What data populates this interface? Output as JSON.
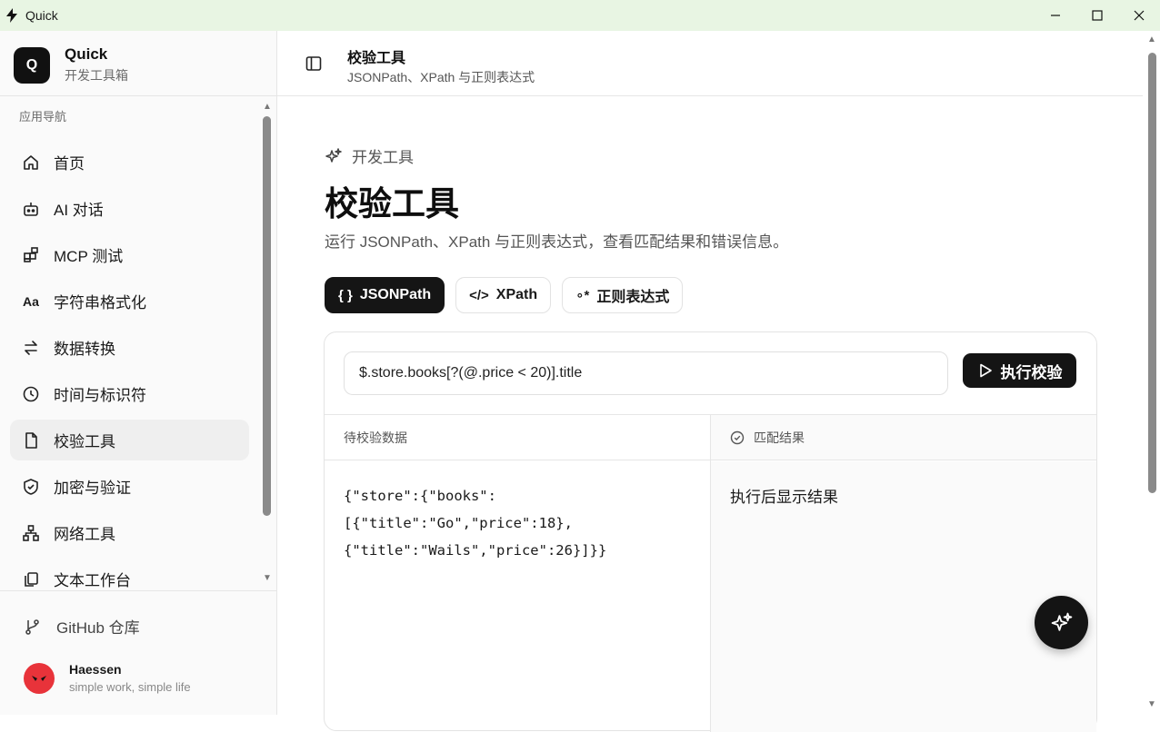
{
  "window": {
    "title": "Quick",
    "controls": [
      "minimize-icon",
      "maximize-icon",
      "close-icon"
    ]
  },
  "sidebar": {
    "brand": {
      "logo_letter": "Q",
      "name": "Quick",
      "subtitle": "开发工具箱"
    },
    "nav_title": "应用导航",
    "items": [
      {
        "label": "首页",
        "icon": "home-icon"
      },
      {
        "label": "AI 对话",
        "icon": "bot-icon"
      },
      {
        "label": "MCP 测试",
        "icon": "blocks-icon"
      },
      {
        "label": "字符串格式化",
        "icon": "case-icon"
      },
      {
        "label": "数据转换",
        "icon": "arrows-swap-icon"
      },
      {
        "label": "时间与标识符",
        "icon": "clock-icon"
      },
      {
        "label": "校验工具",
        "icon": "file-check-icon",
        "active": true
      },
      {
        "label": "加密与验证",
        "icon": "shield-icon"
      },
      {
        "label": "网络工具",
        "icon": "network-icon"
      },
      {
        "label": "文本工作台",
        "icon": "copy-icon"
      }
    ],
    "github_label": "GitHub 仓库",
    "user": {
      "name": "Haessen",
      "motto": "simple work, simple life"
    }
  },
  "header": {
    "title": "校验工具",
    "subtitle": "JSONPath、XPath 与正则表达式"
  },
  "main": {
    "eyebrow": "开发工具",
    "title": "校验工具",
    "description": "运行 JSONPath、XPath 与正则表达式，查看匹配结果和错误信息。",
    "tabs": [
      {
        "label": "JSONPath",
        "icon_text": "{ }",
        "active": true
      },
      {
        "label": "XPath",
        "icon_text": "</>",
        "active": false
      },
      {
        "label": "正则表达式",
        "icon_text": "∘*",
        "active": false
      }
    ],
    "query_value": "$.store.books[?(@.price < 20)].title",
    "run_label": "执行校验",
    "input_pane_title": "待校验数据",
    "input_data": "{\"store\":{\"books\":\n[{\"title\":\"Go\",\"price\":18},\n{\"title\":\"Wails\",\"price\":26}]}}",
    "result_pane_title": "匹配结果",
    "result_placeholder": "执行后显示结果"
  },
  "colors": {
    "titlebar_bg": "#e8f5e3",
    "primary_dark": "#141414",
    "avatar_red": "#e8333a"
  }
}
